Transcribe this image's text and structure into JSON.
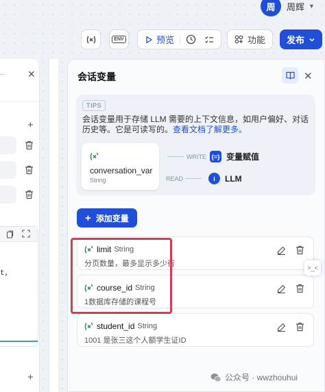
{
  "user": {
    "avatar_initial": "周",
    "name": "周辉"
  },
  "toolbar": {
    "preview_label": "预览",
    "features_label": "功能",
    "publish_label": "发布",
    "env_icon_text": "ENV"
  },
  "panel": {
    "title": "会话变量",
    "tips": {
      "tag": "TIPS",
      "text": "会话变量用于存储 LLM 需要的上下文信息，如用户偏好、对话历史等。它是可读写的。",
      "link": "查看文档了解更多。"
    },
    "example_var": {
      "name": "conversation_var",
      "type": "String"
    },
    "flows": [
      {
        "direction": "WRITE",
        "icon": "{=}",
        "target": "变量赋值"
      },
      {
        "direction": "READ",
        "icon": "i",
        "target": "LLM"
      }
    ],
    "add_button_label": "添加变量",
    "variables": [
      {
        "name": "limit",
        "type": "String",
        "description": "分页数量，最多显示多少行"
      },
      {
        "name": "course_id",
        "type": "String",
        "description": "1数据库存储的课程号"
      },
      {
        "name": "student_id",
        "type": "String",
        "description": "1001 是张三这个人额学生证ID"
      }
    ]
  },
  "side_tab_text": ">_<",
  "watermark": {
    "text": "公众号 · wwzhouhui"
  },
  "colors": {
    "accent": "#1f4fd8",
    "highlight": "#e0384b",
    "var_icon": "#2e7d5b"
  }
}
